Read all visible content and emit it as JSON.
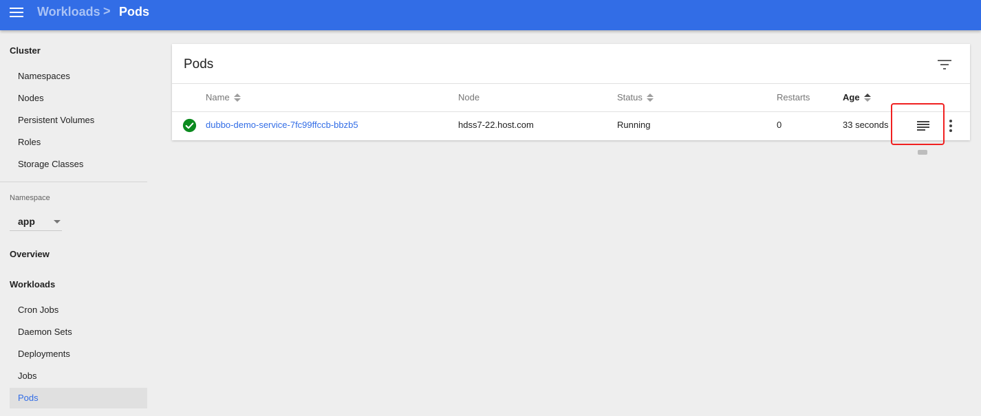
{
  "header": {
    "menu_icon": "hamburger-menu-icon",
    "breadcrumb_parent": "Workloads",
    "breadcrumb_separator": ">",
    "breadcrumb_current": "Pods",
    "bar_color": "#326de6"
  },
  "sidebar": {
    "cluster_heading": "Cluster",
    "cluster_items": [
      "Namespaces",
      "Nodes",
      "Persistent Volumes",
      "Roles",
      "Storage Classes"
    ],
    "namespace_label": "Namespace",
    "namespace_value": "app",
    "overview": "Overview",
    "workloads_heading": "Workloads",
    "workload_items": [
      "Cron Jobs",
      "Daemon Sets",
      "Deployments",
      "Jobs",
      "Pods"
    ],
    "active_item": "Pods"
  },
  "card": {
    "title": "Pods",
    "filter_icon": "filter-list-icon",
    "columns": {
      "name": "Name",
      "node": "Node",
      "status": "Status",
      "restarts": "Restarts",
      "age": "Age"
    },
    "rows": [
      {
        "status_icon": "check-circle-icon",
        "name": "dubbo-demo-service-7fc99ffccb-bbzb5",
        "node": "hdss7-22.host.com",
        "status": "Running",
        "restarts": "0",
        "age": "33 seconds",
        "logs_icon": "logs-icon",
        "more_icon": "more-vert-icon"
      }
    ]
  },
  "colors": {
    "accent": "#326de6",
    "success": "#0b8a1e",
    "highlight": "#f02020"
  }
}
